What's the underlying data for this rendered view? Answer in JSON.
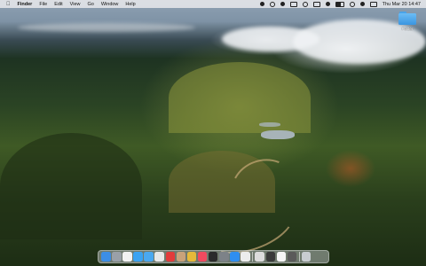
{
  "menubar": {
    "apple_icon": "apple-icon",
    "app_name": "Finder",
    "menus": [
      "File",
      "Edit",
      "View",
      "Go",
      "Window",
      "Help"
    ],
    "datetime": "Thu Mar 20  14:47"
  },
  "desktop": {
    "folder_label": "Folder"
  },
  "dock": {
    "icons": [
      {
        "name": "finder-icon",
        "color": "#3d8ee6"
      },
      {
        "name": "launchpad-icon",
        "color": "#9aa0a8"
      },
      {
        "name": "calendar-icon",
        "color": "#f2f2f2"
      },
      {
        "name": "safari-icon",
        "color": "#3ba3f2"
      },
      {
        "name": "mail-icon",
        "color": "#4aa8f0"
      },
      {
        "name": "photos-icon",
        "color": "#e8e8e8"
      },
      {
        "name": "music-red-icon",
        "color": "#e23b3b"
      },
      {
        "name": "contacts-icon",
        "color": "#c9a27a"
      },
      {
        "name": "notes-icon",
        "color": "#e5b93a"
      },
      {
        "name": "music-icon",
        "color": "#f04a5f"
      },
      {
        "name": "terminal-icon",
        "color": "#2b2b2b"
      },
      {
        "name": "system-settings-icon",
        "color": "#7d8288"
      },
      {
        "name": "app-store-icon",
        "color": "#2f8ef0"
      },
      {
        "name": "preview-icon",
        "color": "#ededed"
      },
      {
        "name": "window-1-icon",
        "color": "#dcdcdc"
      },
      {
        "name": "window-2-icon",
        "color": "#3a3a3a"
      },
      {
        "name": "window-3-icon",
        "color": "#f5f5f5"
      },
      {
        "name": "window-4-icon",
        "color": "#5a5a5a"
      },
      {
        "name": "trash-icon",
        "color": "#c8ccd0"
      }
    ]
  }
}
